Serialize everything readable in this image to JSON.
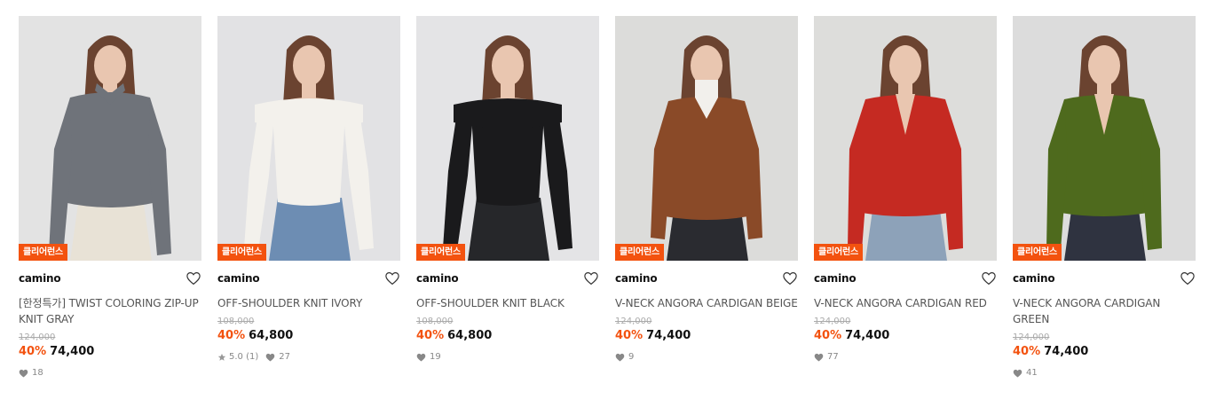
{
  "products": [
    {
      "badge": "클리어런스",
      "brand": "camino",
      "name": "[한정특가] TWIST COLORING ZIP-UP KNIT GRAY",
      "original_price": "124,000",
      "discount": "40%",
      "price": "74,400",
      "rating": "",
      "likes": "18",
      "garment_color": "#6f737a",
      "bottom_color": "#e8e2d6",
      "bg_color": "#e3e3e3",
      "garment": "zip-knit"
    },
    {
      "badge": "클리어런스",
      "brand": "camino",
      "name": "OFF-SHOULDER KNIT IVORY",
      "original_price": "108,000",
      "discount": "40%",
      "price": "64,800",
      "rating": "5.0 (1)",
      "likes": "27",
      "garment_color": "#f3f1ec",
      "bottom_color": "#6d8db3",
      "bg_color": "#e2e2e4",
      "garment": "off-shoulder"
    },
    {
      "badge": "클리어런스",
      "brand": "camino",
      "name": "OFF-SHOULDER KNIT BLACK",
      "original_price": "108,000",
      "discount": "40%",
      "price": "64,800",
      "rating": "",
      "likes": "19",
      "garment_color": "#1a1a1c",
      "bottom_color": "#26272a",
      "bg_color": "#e4e4e6",
      "garment": "off-shoulder"
    },
    {
      "badge": "클리어런스",
      "brand": "camino",
      "name": "V-NECK ANGORA CARDIGAN BEIGE",
      "original_price": "124,000",
      "discount": "40%",
      "price": "74,400",
      "rating": "",
      "likes": "9",
      "garment_color": "#8a4a28",
      "bottom_color": "#2a2b30",
      "bg_color": "#dcdcda",
      "garment": "cardigan-turtle"
    },
    {
      "badge": "클리어런스",
      "brand": "camino",
      "name": "V-NECK ANGORA CARDIGAN RED",
      "original_price": "124,000",
      "discount": "40%",
      "price": "74,400",
      "rating": "",
      "likes": "77",
      "garment_color": "#c52a22",
      "bottom_color": "#8da2b9",
      "bg_color": "#dddddb",
      "garment": "cardigan"
    },
    {
      "badge": "클리어런스",
      "brand": "camino",
      "name": "V-NECK ANGORA CARDIGAN GREEN",
      "original_price": "124,000",
      "discount": "40%",
      "price": "74,400",
      "rating": "",
      "likes": "41",
      "garment_color": "#4e6a1d",
      "bottom_color": "#2f3340",
      "bg_color": "#dcdcdc",
      "garment": "cardigan"
    }
  ],
  "colors": {
    "accent": "#f3520f",
    "skin": "#e9c6b0",
    "hair": "#6b4330"
  }
}
